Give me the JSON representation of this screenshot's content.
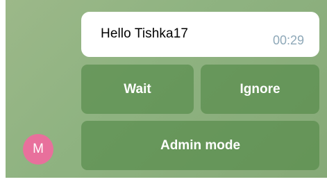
{
  "message": {
    "text": "Hello Tishka17",
    "time": "00:29"
  },
  "keyboard": {
    "wait_label": "Wait",
    "ignore_label": "Ignore",
    "admin_label": "Admin mode"
  },
  "avatar": {
    "initial": "M",
    "color": "#e8709c"
  },
  "colors": {
    "chat_background": "#8fb381",
    "button_background": "#5f9556",
    "bubble_background": "#ffffff",
    "time_text": "#8ea8b8"
  }
}
